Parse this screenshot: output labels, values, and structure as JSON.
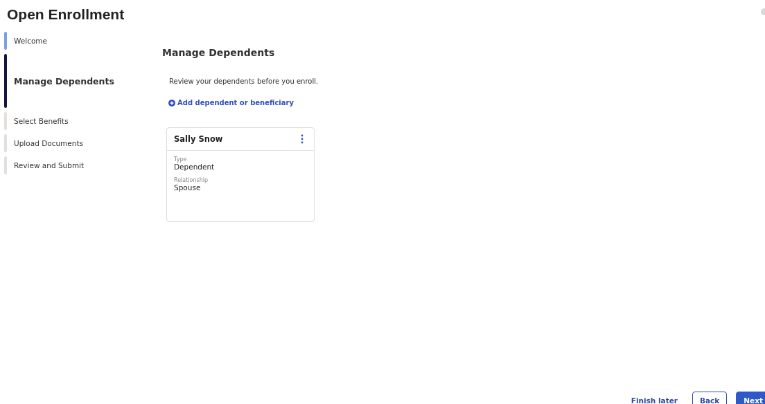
{
  "page": {
    "title": "Open Enrollment"
  },
  "steps": [
    {
      "label": "Welcome",
      "completed": true,
      "selected": false
    },
    {
      "label": "Manage Dependents",
      "completed": false,
      "selected": true
    },
    {
      "label": "Select Benefits",
      "completed": false,
      "selected": false
    },
    {
      "label": "Upload Documents",
      "completed": false,
      "selected": false
    },
    {
      "label": "Review and Submit",
      "completed": false,
      "selected": false
    }
  ],
  "content": {
    "heading": "Manage Dependents",
    "intro": "Review your dependents before you enroll.",
    "add_link": "Add dependent or beneficiary",
    "dependents": [
      {
        "name": "Sally Snow",
        "fields": [
          {
            "label": "Type",
            "value": "Dependent"
          },
          {
            "label": "Relationship",
            "value": "Spouse"
          }
        ]
      }
    ]
  },
  "footer": {
    "finish_later": "Finish later",
    "back": "Back",
    "next": "Next"
  }
}
